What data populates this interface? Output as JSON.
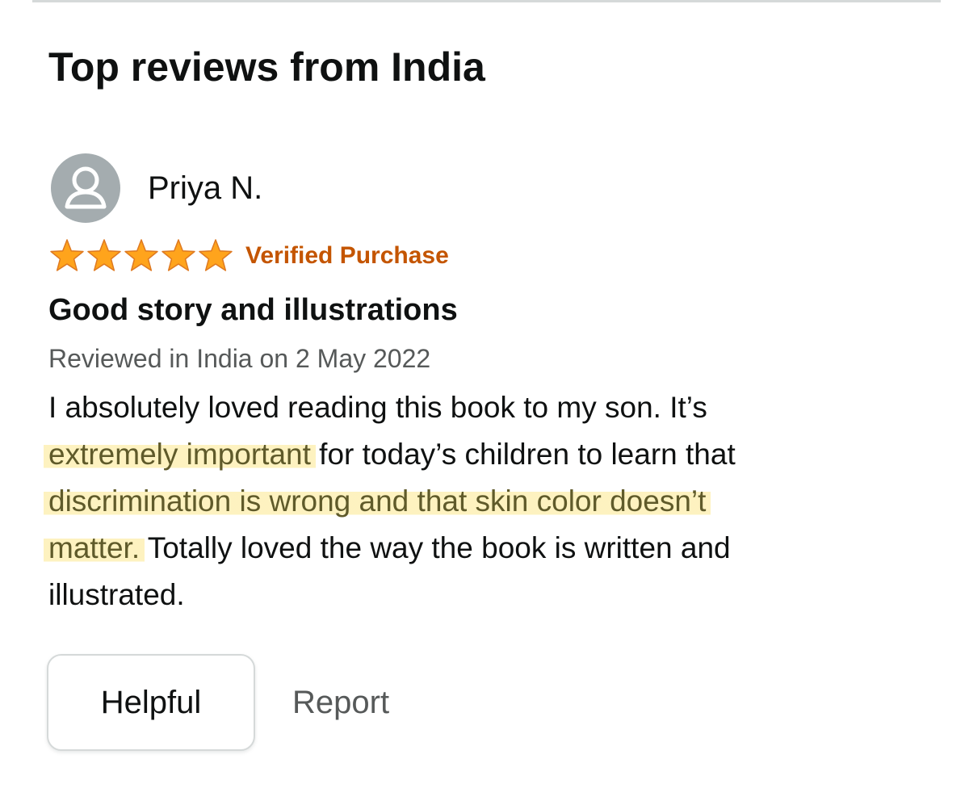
{
  "section": {
    "title": "Top reviews from India"
  },
  "review": {
    "reviewer_name": "Priya N.",
    "avatar_icon": "default-user-icon",
    "rating": 5,
    "rating_max": 5,
    "star_color": "#ffa41c",
    "verified_label": "Verified Purchase",
    "verified_color": "#c45500",
    "title": "Good story and illustrations",
    "date_text": "Reviewed in India on 2 May 2022",
    "body": {
      "line1": "I absolutely loved reading this book to my son. It’s",
      "line2_highlight": "extremely important",
      "line2_rest": " for today’s children to learn that",
      "line3_highlight": "discrimination is wrong and that skin color doesn’t",
      "line4_highlight": "matter.",
      "line4_rest": " Totally loved the way the book is written and",
      "line5": "illustrated."
    },
    "highlight_color": "#fce88c"
  },
  "actions": {
    "helpful_label": "Helpful",
    "report_label": "Report"
  }
}
